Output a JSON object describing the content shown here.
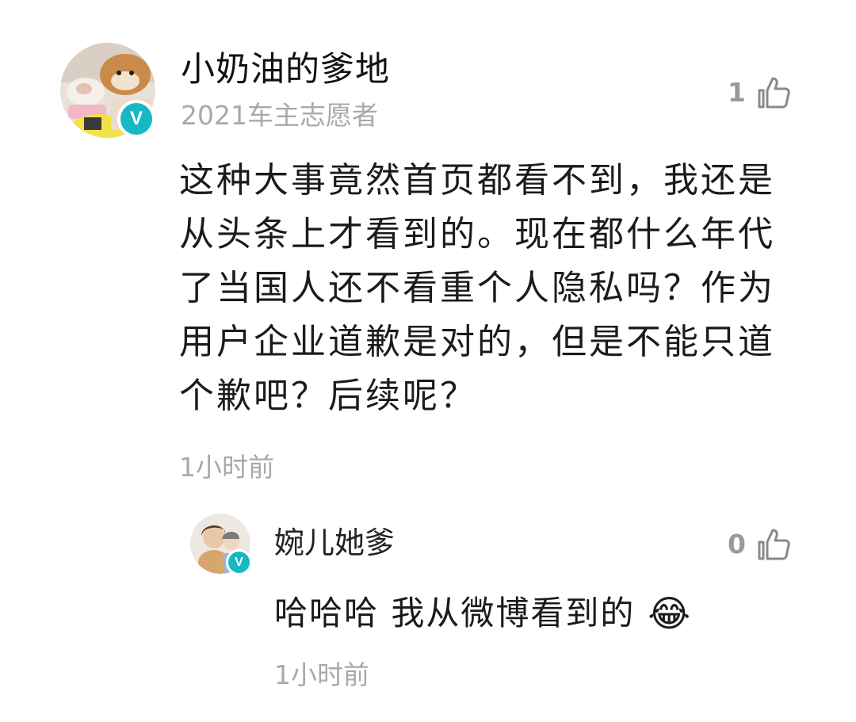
{
  "comment": {
    "username": "小奶油的爹地",
    "badge": "2021车主志愿者",
    "like_count": "1",
    "text": "这种大事竟然首页都看不到，我还是从头条上才看到的。现在都什么年代了当国人还不看重个人隐私吗？作为用户企业道歉是对的，但是不能只道个歉吧？后续呢？",
    "time": "1小时前",
    "verified_mark": "V"
  },
  "reply": {
    "username": "婉儿她爹",
    "like_count": "0",
    "text": "哈哈哈 我从微博看到的",
    "emoji": "😂",
    "time": "1小时前",
    "verified_mark": "V"
  },
  "colors": {
    "verified_badge": "#16b8c4",
    "muted_text": "#a9a9a9",
    "body_text": "#1b1b1b"
  },
  "icons": [
    "thumbs-up-icon",
    "verified-badge-icon",
    "tears-of-joy-emoji"
  ]
}
